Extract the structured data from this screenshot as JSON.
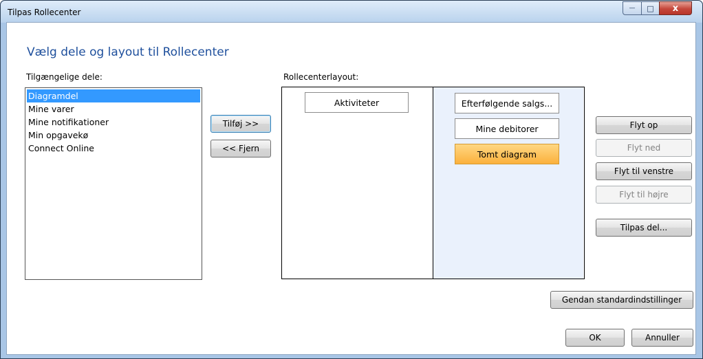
{
  "window": {
    "title": "Tilpas Rollecenter",
    "controls": {
      "minimize": "—",
      "maximize": "□",
      "close": "x"
    }
  },
  "heading": "Vælg dele og layout til Rollecenter",
  "available": {
    "label": "Tilgængelige dele:",
    "items": [
      "Diagramdel",
      "Mine varer",
      "Mine notifikationer",
      "Min opgavekø",
      "Connect Online"
    ],
    "selected_index": 0
  },
  "transfer": {
    "add_label": "Tilføj >>",
    "remove_label": "<< Fjern"
  },
  "layout": {
    "label": "Rollecenterlayout:",
    "column1": [
      "Aktiviteter"
    ],
    "column2": [
      "Efterfølgende salgs...",
      "Mine debitorer",
      "Tomt diagram"
    ],
    "selected_part": "Tomt diagram"
  },
  "actions": {
    "move_up": "Flyt op",
    "move_down": "Flyt ned",
    "move_left": "Flyt til venstre",
    "move_right": "Flyt til højre",
    "customize": "Tilpas del..."
  },
  "footer": {
    "restore_defaults": "Gendan standardindstillinger",
    "ok": "OK",
    "cancel": "Annuller"
  },
  "colors": {
    "heading": "#1e4f9c",
    "selection": "#3399ff",
    "selected_part": "#fbb13c",
    "column2_background": "#eaf1fc",
    "close_button": "#c5473b"
  }
}
